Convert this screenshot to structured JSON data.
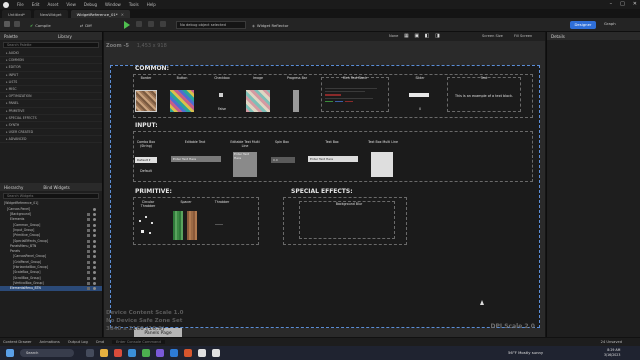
{
  "titlebar": {
    "menu": [
      "File",
      "Edit",
      "Asset",
      "View",
      "Debug",
      "Window",
      "Tools",
      "Help"
    ],
    "controls": [
      "–",
      "□",
      "✕"
    ]
  },
  "tabs": [
    "Untitled*",
    "NewWidget",
    "WidgetReference_01*"
  ],
  "toolbar": {
    "compile": "Compile",
    "diff": "Diff",
    "debug_placeholder": "No debug object selected",
    "reflector": "Widget Reflector",
    "designer": "Designer",
    "graph": "Graph"
  },
  "palette": {
    "tab1": "Palette",
    "tab2": "Library",
    "search_placeholder": "Search Palette",
    "categories": [
      "AUDIO",
      "COMMON",
      "EDITOR",
      "INPUT",
      "LISTS",
      "MISC",
      "OPTIMIZATION",
      "PANEL",
      "PRIMITIVE",
      "SPECIAL EFFECTS",
      "SYNTH",
      "USER CREATED",
      "ADVANCED"
    ]
  },
  "hierarchy": {
    "tab1": "Hierarchy",
    "tab2": "Bind Widgets",
    "search_placeholder": "Search Widgets",
    "rows": [
      "[WidgetReference_01]",
      "[Canvas Panel]",
      "[Background]",
      "Elements",
      "[Common_Group]",
      "[Input_Group]",
      "[Primitive_Group]",
      "[SpecialEffects_Group]",
      "PanelsMenu_BTN",
      "Panels",
      "[CanvasPanel_Group]",
      "[GridPanel_Group]",
      "[HorizontalBox_Group]",
      "[ScaleBox_Group]",
      "[ScrollBox_Group]",
      "[VerticalBox_Group]",
      "ElementsMenu_BTN"
    ]
  },
  "viewport": {
    "zoom_label": "Zoom -5",
    "zoom_size": "1,453 x 918",
    "toolbar_items": [
      "None",
      "Screen Size",
      "Fill Screen"
    ],
    "scale_lines": [
      "Device Content Scale 1.0",
      "No Device Safe Zone Set",
      "3840 x 2160 (16:9)"
    ],
    "dpi": "DPI Scale 2.0",
    "panels_page_button": "Panels Page"
  },
  "sections": {
    "common": "COMMON:",
    "input": "INPUT:",
    "primitive": "PRIMITIVE:",
    "special": "SPECIAL EFFECTS:"
  },
  "common_widgets": {
    "border": "Border",
    "button": "Button",
    "checkbox": "Checkbox",
    "checkbox_value": "False",
    "image": "Image",
    "progress": "Progress Bar",
    "richtext": "Rich Text Block",
    "slider": "Slider",
    "slider_value": "0",
    "text": "Text",
    "text_value": "This is an example of a text block."
  },
  "input_widgets": {
    "combo": "Combo Box (String)",
    "combo_value": "Default",
    "combo_value2": "Default",
    "editable_text": "Editable Text",
    "editable_text_value": "Enter Text Here",
    "editable_ml": "Editable Text Multi Line",
    "editable_ml_value": "Enter Text Here",
    "spin": "Spin Box",
    "spin_value": "0.0",
    "textbox": "Text Box",
    "textbox_value": "Enter Text Here",
    "textbox_ml": "Text Box Multi Line"
  },
  "primitive_widgets": {
    "circular": "Circular Throbber",
    "spacer": "Spacer",
    "throbber": "Throbber"
  },
  "special_widgets": {
    "bg_blur": "Background Blur"
  },
  "details": {
    "title": "Details"
  },
  "statusbar": {
    "items": [
      "Content Drawer",
      "Animations",
      "Output Log",
      "Cmd",
      "Enter Console Command"
    ],
    "right": "24 Unsaved"
  },
  "taskbar": {
    "search": "Search",
    "weather": "56°F Mostly sunny",
    "time": "8:29 AM",
    "date": "3/16/2023"
  },
  "colors": {
    "accent": "#2f6fd8",
    "canvas_border": "#5b8dd6",
    "play": "#4fbf4f"
  }
}
